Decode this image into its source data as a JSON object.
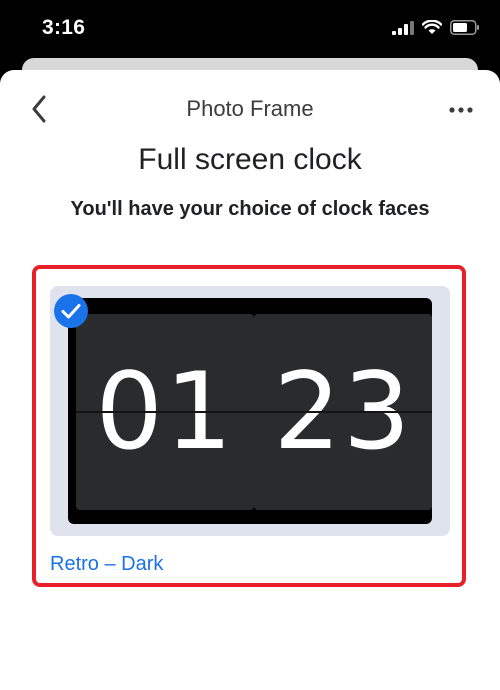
{
  "status_bar": {
    "time": "3:16"
  },
  "nav": {
    "title": "Photo Frame"
  },
  "content": {
    "heading": "Full screen clock",
    "subheading": "You'll have your choice of clock faces"
  },
  "clock_face": {
    "hours": "01",
    "minutes": "23",
    "label": "Retro – Dark",
    "selected": true
  },
  "colors": {
    "accent": "#1a73e8",
    "highlight": "#e8202a"
  }
}
